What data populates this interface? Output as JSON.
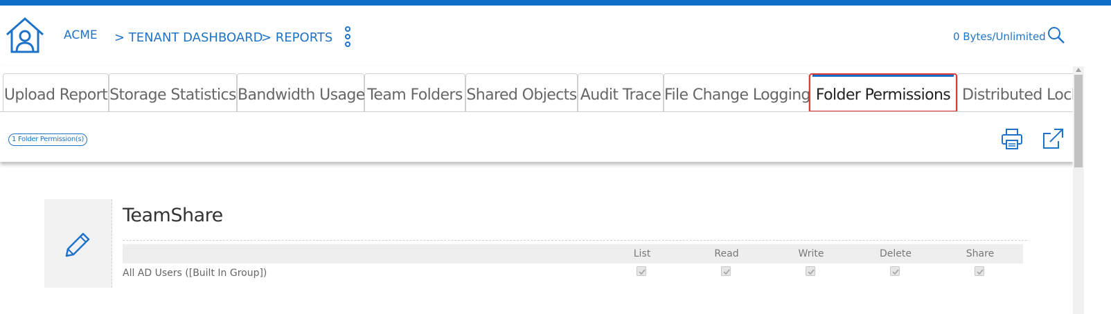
{
  "header": {
    "breadcrumbs": [
      "ACME",
      "> TENANT DASHBOARD",
      ">  REPORTS"
    ],
    "quota": "0 Bytes/Unlimited"
  },
  "tabs": [
    {
      "label": "Upload Report"
    },
    {
      "label": "Storage Statistics"
    },
    {
      "label": "Bandwidth Usage"
    },
    {
      "label": "Team Folders"
    },
    {
      "label": "Shared Objects"
    },
    {
      "label": "Audit Trace"
    },
    {
      "label": "File Change Logging"
    },
    {
      "label": "Folder Permissions",
      "active": true
    },
    {
      "label": "Distributed Locks"
    }
  ],
  "summary": {
    "badge": "1 Folder Permission(s)"
  },
  "folder": {
    "name": "TeamShare",
    "columns": [
      "List",
      "Read",
      "Write",
      "Delete",
      "Share"
    ],
    "rows": [
      {
        "principal": "All AD Users ([Built In Group])",
        "list": true,
        "read": true,
        "write": true,
        "delete": true,
        "share": true
      }
    ]
  },
  "colors": {
    "accent": "#0f6fc6",
    "link": "#1e73c8",
    "highlight": "#e03a3a"
  }
}
